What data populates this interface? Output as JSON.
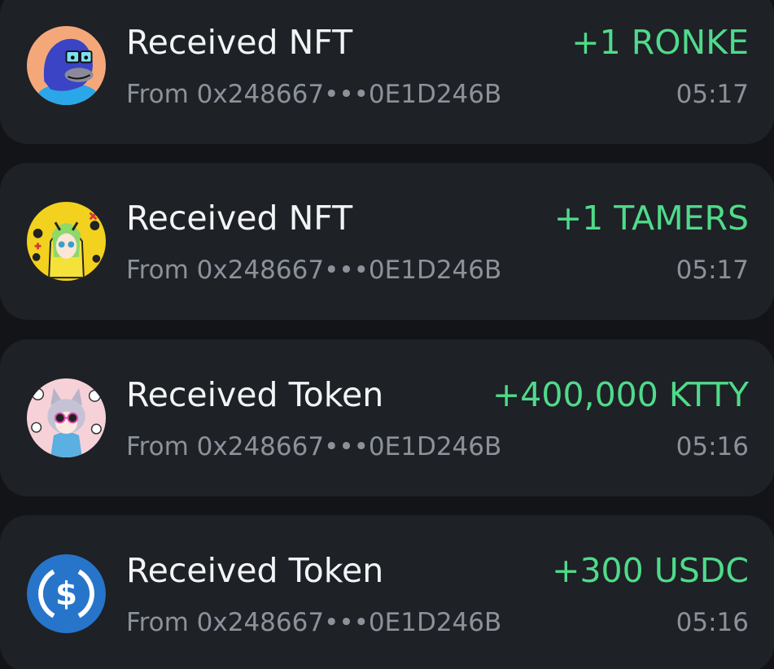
{
  "transactions": [
    {
      "title": "Received NFT",
      "amount": "+1 RONKE",
      "from_prefix": "From",
      "address": "0x248667•••0E1D246B",
      "time": "05:17",
      "icon": "ronke-ape-avatar-icon"
    },
    {
      "title": "Received NFT",
      "amount": "+1 TAMERS",
      "from_prefix": "From",
      "address": "0x248667•••0E1D246B",
      "time": "05:17",
      "icon": "tamers-anime-avatar-icon"
    },
    {
      "title": "Received Token",
      "amount": "+400,000 KTTY",
      "from_prefix": "From",
      "address": "0x248667•••0E1D246B",
      "time": "05:16",
      "icon": "ktty-cat-avatar-icon"
    },
    {
      "title": "Received Token",
      "amount": "+300 USDC",
      "from_prefix": "From",
      "address": "0x248667•••0E1D246B",
      "time": "05:16",
      "icon": "usdc-icon"
    }
  ],
  "colors": {
    "background": "#121417",
    "card": "#1e2126",
    "title": "#f3f4f6",
    "amount_positive": "#4fdb8a",
    "secondary_text": "#8c929b",
    "usdc_blue": "#2775ca"
  }
}
